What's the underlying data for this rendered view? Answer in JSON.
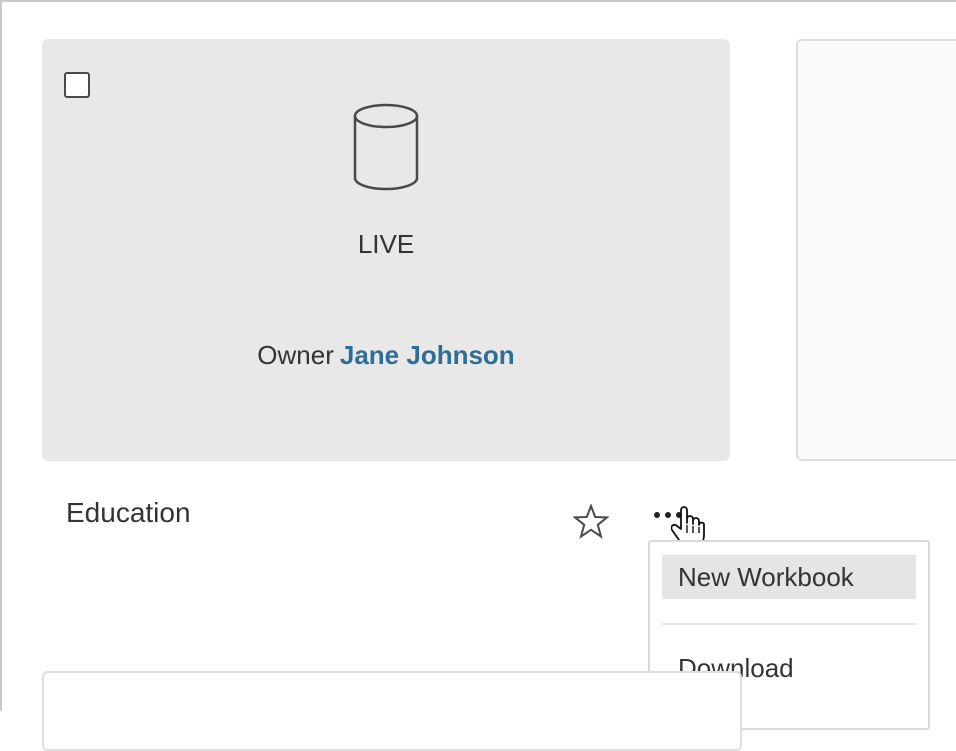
{
  "card": {
    "icon": "database-icon",
    "connection_type": "LIVE",
    "owner_label": "Owner",
    "owner_name": "Jane Johnson"
  },
  "datasource": {
    "name": "Education",
    "favorite_icon": "star-icon",
    "more_icon": "more-actions-icon"
  },
  "menu": {
    "items": [
      {
        "label": "New Workbook"
      },
      {
        "label": "Download"
      }
    ]
  },
  "colors": {
    "card_background": "#e8e8e8",
    "owner_link": "#2e6d96",
    "menu_highlight": "#e5e5e5"
  }
}
